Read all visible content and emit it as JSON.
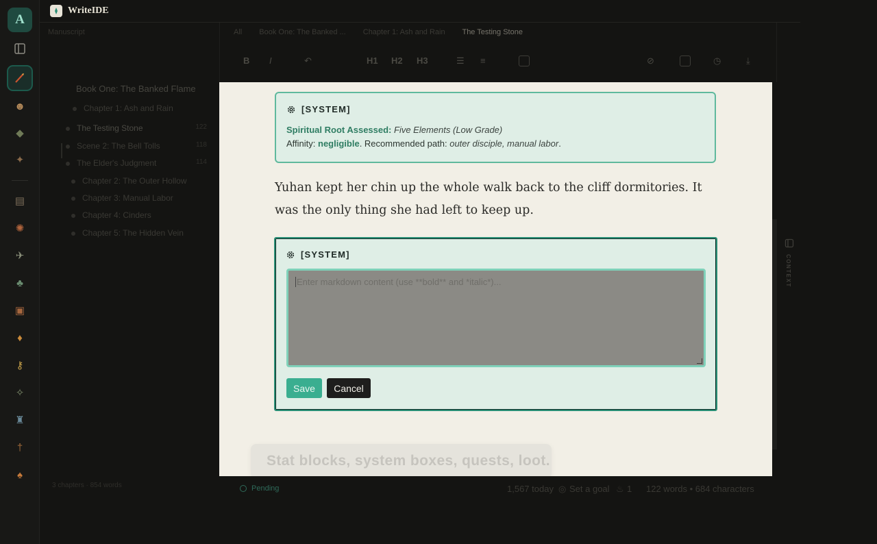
{
  "app": {
    "name": "WriteIDE",
    "logo_letter": "A"
  },
  "sidebar": {
    "header": "Manuscript",
    "book": "Book One: The Banked Flame",
    "items": [
      {
        "label": "Chapter 1: Ash and Rain",
        "count": ""
      },
      {
        "label": "The Testing Stone",
        "count": "122"
      },
      {
        "label": "Scene 2: The Bell Tolls",
        "count": "118"
      },
      {
        "label": "The Elder's Judgment",
        "count": "114"
      },
      {
        "label": "Chapter 2: The Outer Hollow",
        "count": ""
      },
      {
        "label": "Chapter 3: Manual Labor",
        "count": ""
      },
      {
        "label": "Chapter 4: Cinders",
        "count": ""
      },
      {
        "label": "Chapter 5: The Hidden Vein",
        "count": ""
      }
    ],
    "footer": "3 chapters · 854 words"
  },
  "breadcrumb": [
    "All",
    "Book One: The Banked ...",
    "Chapter 1: Ash and Rain",
    "The Testing Stone"
  ],
  "toolbar": {
    "h1": "H1",
    "h2": "H2",
    "h3": "H3"
  },
  "system_box": {
    "title": "[SYSTEM]",
    "line1_label": "Spiritual Root Assessed:",
    "line1_value": "Five Elements (Low Grade)",
    "line2_prefix": "Affinity:",
    "line2_bold": "negligible",
    "line2_mid": ". Recommended path:",
    "line2_italic": "outer disciple, manual labor",
    "line2_end": "."
  },
  "prose": "Yuhan kept her chin up the whole walk back to the cliff dormitories. It was the only thing she had left to keep up.",
  "edit_box": {
    "title": "[SYSTEM]",
    "placeholder": "Enter markdown content (use **bold** and *italic*)...",
    "save_label": "Save",
    "cancel_label": "Cancel"
  },
  "tooltip": "Stat blocks, system boxes, quests, loot.",
  "context_label": "CONTEXT",
  "status": {
    "pending": "Pending",
    "today": "1,567 today",
    "goal": "Set a goal",
    "streak": "1",
    "stats": "122 words • 684 characters"
  }
}
